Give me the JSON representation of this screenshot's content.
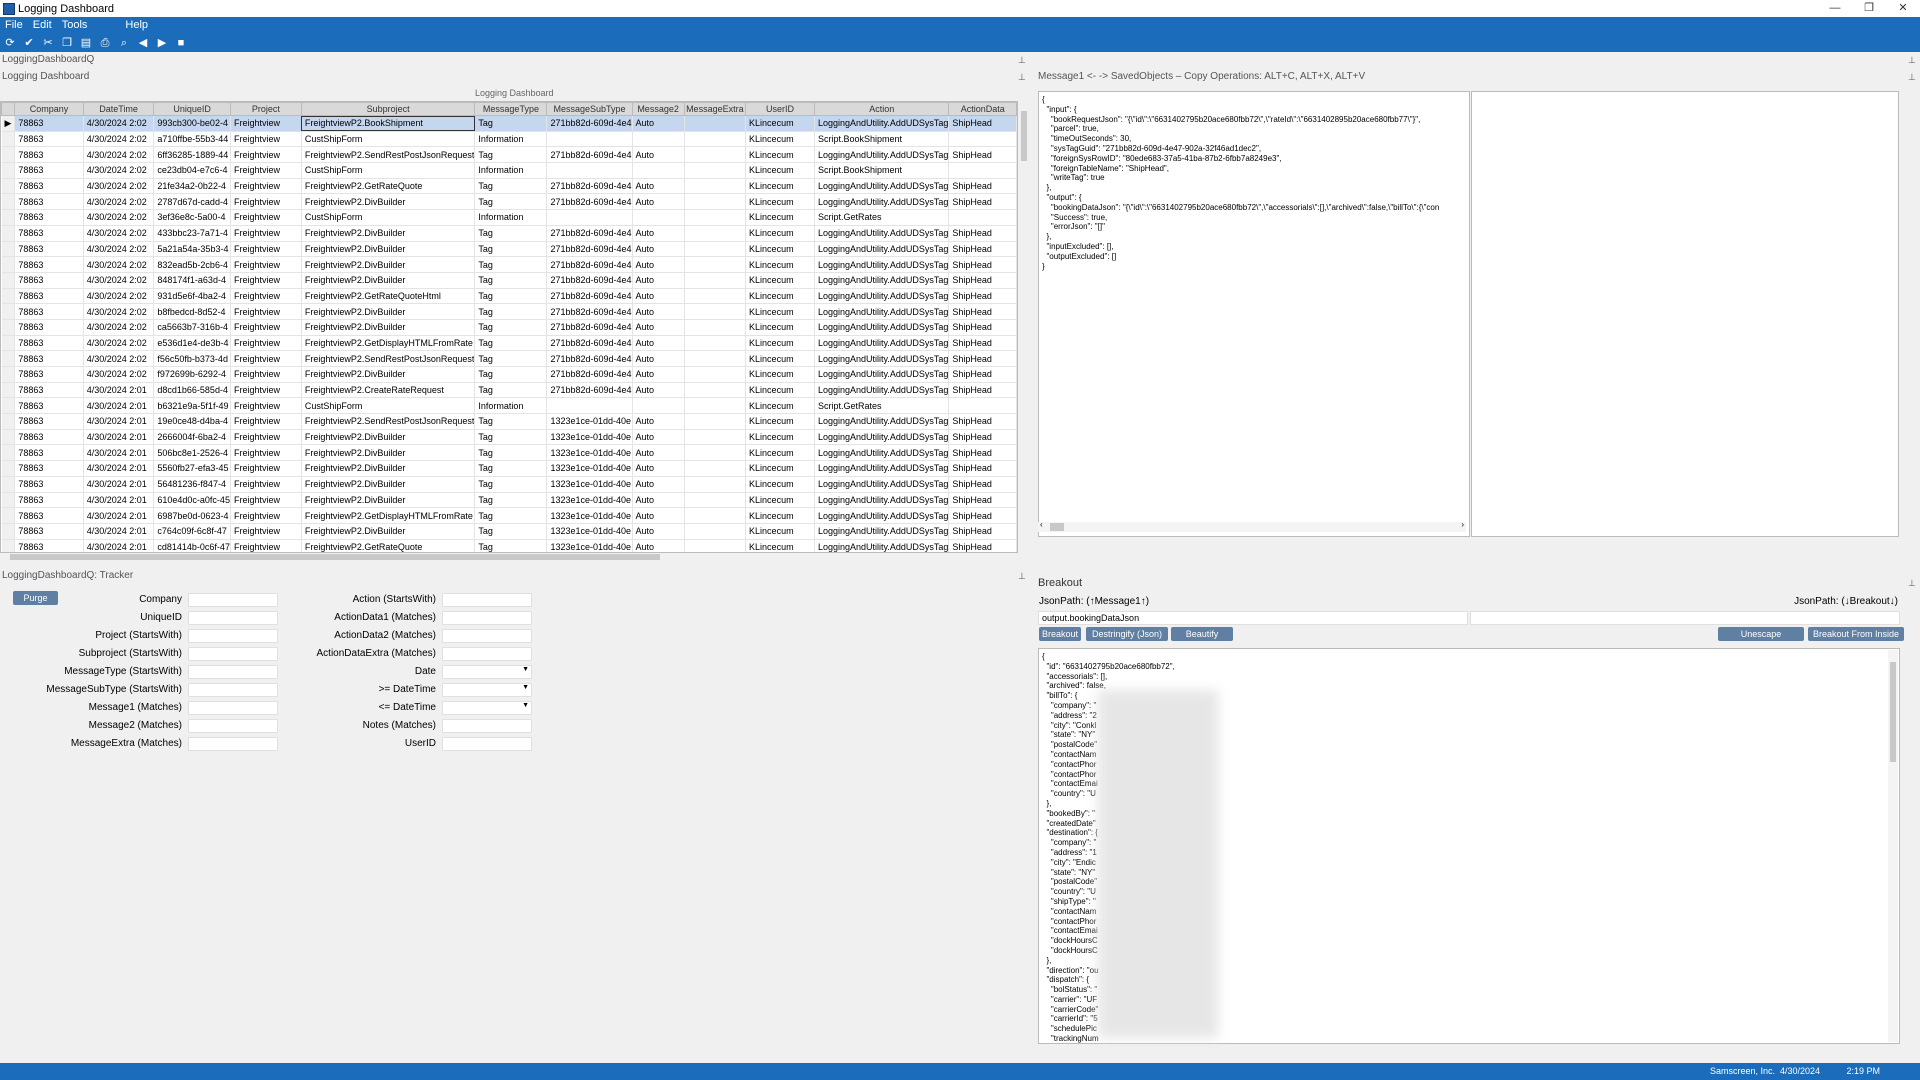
{
  "window": {
    "title": "Logging Dashboard",
    "controls": [
      "—",
      "❐",
      "✕"
    ]
  },
  "menu": [
    {
      "label": "File"
    },
    {
      "label": "Edit"
    },
    {
      "label": "Tools"
    },
    {
      "label": "Help"
    }
  ],
  "toolbar_icons": [
    "refresh-icon",
    "check-icon",
    "cut-icon",
    "copy-icon",
    "paste-icon",
    "print-icon",
    "zoom-icon",
    "back-icon",
    "forward-icon",
    "stop-icon"
  ],
  "left": {
    "panel_title": "LoggingDashboardQ",
    "grid_title": "Logging Dashboard",
    "grid_caption": "Logging Dashboard",
    "columns": [
      "Company",
      "DateTime",
      "UniqueID",
      "Project",
      "Subproject",
      "MessageType",
      "MessageSubType",
      "Message2",
      "MessageExtra",
      "UserID",
      "Action",
      "ActionData"
    ],
    "rows": [
      [
        "78863",
        "4/30/2024 2:02",
        "993cb300-be02-4",
        "Freightview",
        "FreightviewP2.BookShipment",
        "Tag",
        "271bb82d-609d-4e4",
        "Auto",
        "",
        "KLincecum",
        "LoggingAndUtility.AddUDSysTag",
        "ShipHead"
      ],
      [
        "78863",
        "4/30/2024 2:02",
        "a710ffbe-55b3-44",
        "Freightview",
        "CustShipForm",
        "Information",
        "",
        "",
        "",
        "KLincecum",
        "Script.BookShipment",
        ""
      ],
      [
        "78863",
        "4/30/2024 2:02",
        "6ff36285-1889-44",
        "Freightview",
        "FreightviewP2.SendRestPostJsonRequest",
        "Tag",
        "271bb82d-609d-4e4",
        "Auto",
        "",
        "KLincecum",
        "LoggingAndUtility.AddUDSysTag",
        "ShipHead"
      ],
      [
        "78863",
        "4/30/2024 2:02",
        "ce23db04-e7c6-4",
        "Freightview",
        "CustShipForm",
        "Information",
        "",
        "",
        "",
        "KLincecum",
        "Script.BookShipment",
        ""
      ],
      [
        "78863",
        "4/30/2024 2:02",
        "21fe34a2-0b22-4",
        "Freightview",
        "FreightviewP2.GetRateQuote",
        "Tag",
        "271bb82d-609d-4e4",
        "Auto",
        "",
        "KLincecum",
        "LoggingAndUtility.AddUDSysTag",
        "ShipHead"
      ],
      [
        "78863",
        "4/30/2024 2:02",
        "2787d67d-cadd-4",
        "Freightview",
        "FreightviewP2.DivBuilder",
        "Tag",
        "271bb82d-609d-4e4",
        "Auto",
        "",
        "KLincecum",
        "LoggingAndUtility.AddUDSysTag",
        "ShipHead"
      ],
      [
        "78863",
        "4/30/2024 2:02",
        "3ef36e8c-5a00-4",
        "Freightview",
        "CustShipForm",
        "Information",
        "",
        "",
        "",
        "KLincecum",
        "Script.GetRates",
        ""
      ],
      [
        "78863",
        "4/30/2024 2:02",
        "433bbc23-7a71-4",
        "Freightview",
        "FreightviewP2.DivBuilder",
        "Tag",
        "271bb82d-609d-4e4",
        "Auto",
        "",
        "KLincecum",
        "LoggingAndUtility.AddUDSysTag",
        "ShipHead"
      ],
      [
        "78863",
        "4/30/2024 2:02",
        "5a21a54a-35b3-4",
        "Freightview",
        "FreightviewP2.DivBuilder",
        "Tag",
        "271bb82d-609d-4e4",
        "Auto",
        "",
        "KLincecum",
        "LoggingAndUtility.AddUDSysTag",
        "ShipHead"
      ],
      [
        "78863",
        "4/30/2024 2:02",
        "832ead5b-2cb6-4",
        "Freightview",
        "FreightviewP2.DivBuilder",
        "Tag",
        "271bb82d-609d-4e4",
        "Auto",
        "",
        "KLincecum",
        "LoggingAndUtility.AddUDSysTag",
        "ShipHead"
      ],
      [
        "78863",
        "4/30/2024 2:02",
        "848174f1-a63d-4",
        "Freightview",
        "FreightviewP2.DivBuilder",
        "Tag",
        "271bb82d-609d-4e4",
        "Auto",
        "",
        "KLincecum",
        "LoggingAndUtility.AddUDSysTag",
        "ShipHead"
      ],
      [
        "78863",
        "4/30/2024 2:02",
        "931d5e6f-4ba2-4",
        "Freightview",
        "FreightviewP2.GetRateQuoteHtml",
        "Tag",
        "271bb82d-609d-4e4",
        "Auto",
        "",
        "KLincecum",
        "LoggingAndUtility.AddUDSysTag",
        "ShipHead"
      ],
      [
        "78863",
        "4/30/2024 2:02",
        "b8fbedcd-8d52-4",
        "Freightview",
        "FreightviewP2.DivBuilder",
        "Tag",
        "271bb82d-609d-4e4",
        "Auto",
        "",
        "KLincecum",
        "LoggingAndUtility.AddUDSysTag",
        "ShipHead"
      ],
      [
        "78863",
        "4/30/2024 2:02",
        "ca5663b7-316b-4",
        "Freightview",
        "FreightviewP2.DivBuilder",
        "Tag",
        "271bb82d-609d-4e4",
        "Auto",
        "",
        "KLincecum",
        "LoggingAndUtility.AddUDSysTag",
        "ShipHead"
      ],
      [
        "78863",
        "4/30/2024 2:02",
        "e536d1e4-de3b-4",
        "Freightview",
        "FreightviewP2.GetDisplayHTMLFromRate",
        "Tag",
        "271bb82d-609d-4e4",
        "Auto",
        "",
        "KLincecum",
        "LoggingAndUtility.AddUDSysTag",
        "ShipHead"
      ],
      [
        "78863",
        "4/30/2024 2:02",
        "f56c50fb-b373-4d",
        "Freightview",
        "FreightviewP2.SendRestPostJsonRequest",
        "Tag",
        "271bb82d-609d-4e4",
        "Auto",
        "",
        "KLincecum",
        "LoggingAndUtility.AddUDSysTag",
        "ShipHead"
      ],
      [
        "78863",
        "4/30/2024 2:02",
        "f972699b-6292-4",
        "Freightview",
        "FreightviewP2.DivBuilder",
        "Tag",
        "271bb82d-609d-4e4",
        "Auto",
        "",
        "KLincecum",
        "LoggingAndUtility.AddUDSysTag",
        "ShipHead"
      ],
      [
        "78863",
        "4/30/2024 2:01",
        "d8cd1b66-585d-4",
        "Freightview",
        "FreightviewP2.CreateRateRequest",
        "Tag",
        "271bb82d-609d-4e4",
        "Auto",
        "",
        "KLincecum",
        "LoggingAndUtility.AddUDSysTag",
        "ShipHead"
      ],
      [
        "78863",
        "4/30/2024 2:01",
        "b6321e9a-5f1f-49",
        "Freightview",
        "CustShipForm",
        "Information",
        "",
        "",
        "",
        "KLincecum",
        "Script.GetRates",
        ""
      ],
      [
        "78863",
        "4/30/2024 2:01",
        "19e0ce48-d4ba-4",
        "Freightview",
        "FreightviewP2.SendRestPostJsonRequest",
        "Tag",
        "1323e1ce-01dd-40e",
        "Auto",
        "",
        "KLincecum",
        "LoggingAndUtility.AddUDSysTag",
        "ShipHead"
      ],
      [
        "78863",
        "4/30/2024 2:01",
        "2666004f-6ba2-4",
        "Freightview",
        "FreightviewP2.DivBuilder",
        "Tag",
        "1323e1ce-01dd-40e",
        "Auto",
        "",
        "KLincecum",
        "LoggingAndUtility.AddUDSysTag",
        "ShipHead"
      ],
      [
        "78863",
        "4/30/2024 2:01",
        "506bc8e1-2526-4",
        "Freightview",
        "FreightviewP2.DivBuilder",
        "Tag",
        "1323e1ce-01dd-40e",
        "Auto",
        "",
        "KLincecum",
        "LoggingAndUtility.AddUDSysTag",
        "ShipHead"
      ],
      [
        "78863",
        "4/30/2024 2:01",
        "5560fb27-efa3-45",
        "Freightview",
        "FreightviewP2.DivBuilder",
        "Tag",
        "1323e1ce-01dd-40e",
        "Auto",
        "",
        "KLincecum",
        "LoggingAndUtility.AddUDSysTag",
        "ShipHead"
      ],
      [
        "78863",
        "4/30/2024 2:01",
        "56481236-f847-4",
        "Freightview",
        "FreightviewP2.DivBuilder",
        "Tag",
        "1323e1ce-01dd-40e",
        "Auto",
        "",
        "KLincecum",
        "LoggingAndUtility.AddUDSysTag",
        "ShipHead"
      ],
      [
        "78863",
        "4/30/2024 2:01",
        "610e4d0c-a0fc-45",
        "Freightview",
        "FreightviewP2.DivBuilder",
        "Tag",
        "1323e1ce-01dd-40e",
        "Auto",
        "",
        "KLincecum",
        "LoggingAndUtility.AddUDSysTag",
        "ShipHead"
      ],
      [
        "78863",
        "4/30/2024 2:01",
        "6987be0d-0623-4",
        "Freightview",
        "FreightviewP2.GetDisplayHTMLFromRate",
        "Tag",
        "1323e1ce-01dd-40e",
        "Auto",
        "",
        "KLincecum",
        "LoggingAndUtility.AddUDSysTag",
        "ShipHead"
      ],
      [
        "78863",
        "4/30/2024 2:01",
        "c764c09f-6c8f-47",
        "Freightview",
        "FreightviewP2.DivBuilder",
        "Tag",
        "1323e1ce-01dd-40e",
        "Auto",
        "",
        "KLincecum",
        "LoggingAndUtility.AddUDSysTag",
        "ShipHead"
      ],
      [
        "78863",
        "4/30/2024 2:01",
        "cd81414b-0c6f-47",
        "Freightview",
        "FreightviewP2.GetRateQuote",
        "Tag",
        "1323e1ce-01dd-40e",
        "Auto",
        "",
        "KLincecum",
        "LoggingAndUtility.AddUDSysTag",
        "ShipHead"
      ]
    ]
  },
  "tracker": {
    "panel_title": "LoggingDashboardQ: Tracker",
    "purge_label": "Purge",
    "left_fields": [
      "Company",
      "UniqueID",
      "Project (StartsWith)",
      "Subproject (StartsWith)",
      "MessageType (StartsWith)",
      "MessageSubType (StartsWith)",
      "Message1 (Matches)",
      "Message2 (Matches)",
      "MessageExtra (Matches)"
    ],
    "right_fields": [
      "Action (StartsWith)",
      "ActionData1 (Matches)",
      "ActionData2 (Matches)",
      "ActionDataExtra (Matches)",
      "Date",
      ">= DateTime",
      "<= DateTime",
      "Notes (Matches)",
      "UserID"
    ]
  },
  "right": {
    "header": "Message1 <-  -> SavedObjects  –  Copy Operations: ALT+C, ALT+X, ALT+V",
    "json_text": "{\n  \"input\": {\n    \"bookRequestJson\": \"{\\\"id\\\":\\\"6631402795b20ace680fbb72\\\",\\\"rateId\\\":\\\"6631402895b20ace680fbb77\\\"}\",\n    \"parcel\": true,\n    \"timeOutSeconds\": 30,\n    \"sysTagGuid\": \"271bb82d-609d-4e47-902a-32f46ad1dec2\",\n    \"foreignSysRowID\": \"80ede683-37a5-41ba-87b2-6fbb7a8249e3\",\n    \"foreignTableName\": \"ShipHead\",\n    \"writeTag\": true\n  },\n  \"output\": {\n    \"bookingDataJson\": \"{\\\"id\\\":\\\"6631402795b20ace680fbb72\\\",\\\"accessorials\\\":[],\\\"archived\\\":false,\\\"billTo\\\":{\\\"con\n    \"Success\": true,\n    \"errorJson\": \"[]\"\n  },\n  \"inputExcluded\": [],\n  \"outputExcluded\": []\n}",
    "breakout_title": "Breakout",
    "jsonpath_left": "JsonPath: (↑Message1↑)",
    "jsonpath_right": "JsonPath: (↓Breakout↓)",
    "path_value": "output.bookingDataJson",
    "buttons": {
      "breakout": "Breakout",
      "destringify": "Destringify (Json)",
      "beautify": "Beautify",
      "unescape": "Unescape",
      "breakout_from_inside": "Breakout From Inside"
    },
    "breakout_text": "{\n  \"id\": \"6631402795b20ace680fbb72\",\n  \"accessorials\": [],\n  \"archived\": false,\n  \"billTo\": {\n    \"company\": \"\n    \"address\": \"2\n    \"city\": \"Conkl\n    \"state\": \"NY\"\n    \"postalCode\"\n    \"contactNam\n    \"contactPhor\n    \"contactPhor\n    \"contactEmai\n    \"country\": \"U\n  },\n  \"bookedBy\": \"\n  \"createdDate\"\n  \"destination\": {\n    \"company\": \"\n    \"address\": \"1\n    \"city\": \"Endic\n    \"state\": \"NY\"\n    \"postalCode\"\n    \"country\": \"U\n    \"shipType\": \"\n    \"contactNam\n    \"contactPhor\n    \"contactEmai\n    \"dockHoursC\n    \"dockHoursC\n  },\n  \"direction\": \"ou\n  \"dispatch\": {\n    \"bolStatus\": \"\n    \"carrier\": \"UF\n    \"carrierCode\"\n    \"carrierId\": \"5\n    \"schedulePic\n    \"trackingNum"
  },
  "status": {
    "company": "Samscreen, Inc.",
    "date": "4/30/2024",
    "time": "2:19 PM"
  }
}
